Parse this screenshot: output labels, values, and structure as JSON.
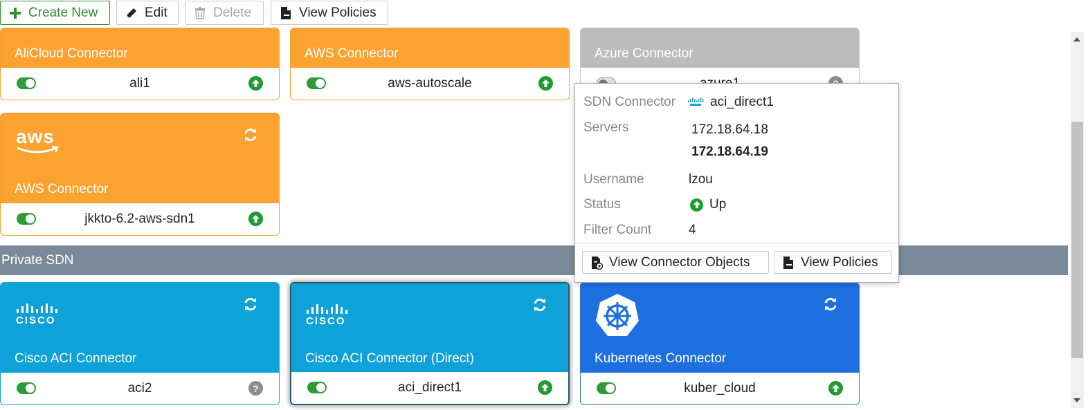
{
  "toolbar": {
    "create_label": "Create New",
    "edit_label": "Edit",
    "delete_label": "Delete",
    "view_policies_label": "View Policies"
  },
  "cards": {
    "alicloud": {
      "title": "AliCloud Connector",
      "name": "ali1",
      "enabled": true,
      "status": "up"
    },
    "aws1": {
      "title": "AWS Connector",
      "name": "aws-autoscale",
      "enabled": true,
      "status": "up"
    },
    "azure": {
      "title": "Azure Connector",
      "name": "azure1",
      "enabled": false,
      "status": "unknown"
    },
    "aws2": {
      "title": "AWS Connector",
      "logo_text": "aws",
      "name": "jkkto-6.2-aws-sdn1",
      "enabled": true,
      "status": "up"
    },
    "cisco1": {
      "title": "Cisco ACI Connector",
      "logo_text": "CISCO",
      "name": "aci2",
      "enabled": true,
      "status": "unknown"
    },
    "cisco2": {
      "title": "Cisco ACI Connector (Direct)",
      "logo_text": "CISCO",
      "name": "aci_direct1",
      "enabled": true,
      "status": "up"
    },
    "kube": {
      "title": "Kubernetes Connector",
      "name": "kuber_cloud",
      "enabled": true,
      "status": "up"
    }
  },
  "section": {
    "private_sdn_label": "Private SDN"
  },
  "popup": {
    "sdn_connector_label": "SDN Connector",
    "sdn_connector_value": "aci_direct1",
    "servers_label": "Servers",
    "server_1": "172.18.64.18",
    "server_2": "172.18.64.19",
    "username_label": "Username",
    "username_value": "lzou",
    "status_label": "Status",
    "status_value": "Up",
    "filter_count_label": "Filter Count",
    "filter_count_value": "4",
    "view_objects_label": "View Connector Objects",
    "view_policies_label": "View Policies"
  },
  "colors": {
    "orange": "#fba231",
    "cisco_blue": "#0ea2d8",
    "kube_blue": "#1e6fe0",
    "azure_gray": "#bcbcbc",
    "status_green": "#1e9b32",
    "section_bar": "#7b8a99"
  },
  "icons": {
    "create": "plus-icon",
    "edit": "pencil-icon",
    "delete": "trash-icon",
    "policies": "document-icon",
    "refresh": "refresh-icon",
    "status_up": "arrow-up-circle-icon",
    "status_unknown": "question-circle-icon"
  }
}
